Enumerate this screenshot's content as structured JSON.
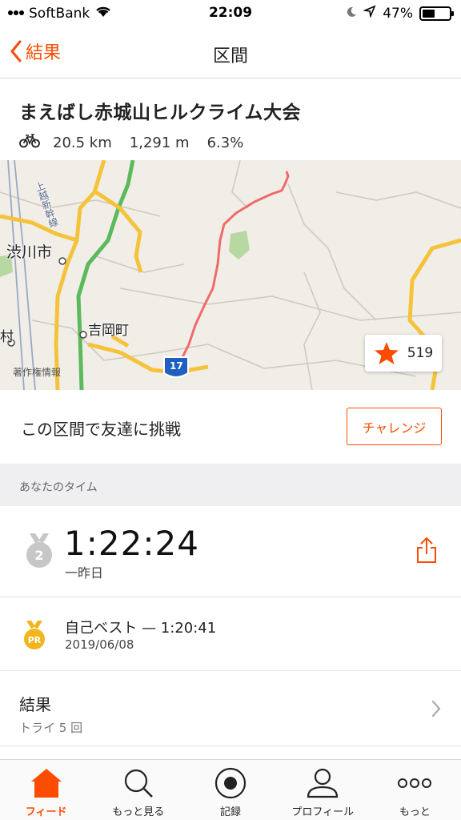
{
  "status_bar": {
    "carrier": "SoftBank",
    "time": "22:09",
    "battery": "47%",
    "battery_level": 0.47
  },
  "nav": {
    "back_label": "結果",
    "title": "区間"
  },
  "segment": {
    "title": "まえばし赤城山ヒルクライム大会",
    "distance": "20.5 km",
    "elevation": "1,291 m",
    "grade": "6.3%"
  },
  "map": {
    "labels": {
      "city1": "渋川市",
      "town1": "吉岡町",
      "rail": "上越新幹線",
      "partial_left": "村",
      "route_number": "17"
    },
    "attribution": "著作権情報",
    "star_count": "519",
    "colors": {
      "route": "#f06a6a",
      "highway": "#f5c33b",
      "expressway": "#5cba5c"
    }
  },
  "challenge": {
    "text": "この区間で友達に挑戦",
    "button_label": "チャレンジ"
  },
  "your_time": {
    "section_label": "あなたのタイム",
    "rank": "2",
    "time": "1:22:24",
    "when": "一昨日"
  },
  "personal_best": {
    "badge": "PR",
    "label": "自己ベスト — 1:20:41",
    "date": "2019/06/08"
  },
  "results": {
    "title": "結果",
    "attempts": "トライ 5 回"
  },
  "tabs": [
    {
      "label": "フィード",
      "icon": "home-icon",
      "active": true
    },
    {
      "label": "もっと見る",
      "icon": "search-icon",
      "active": false
    },
    {
      "label": "記録",
      "icon": "record-icon",
      "active": false
    },
    {
      "label": "プロフィール",
      "icon": "profile-icon",
      "active": false
    },
    {
      "label": "もっと",
      "icon": "more-icon",
      "active": false
    }
  ],
  "accent_color": "#fc4c02"
}
